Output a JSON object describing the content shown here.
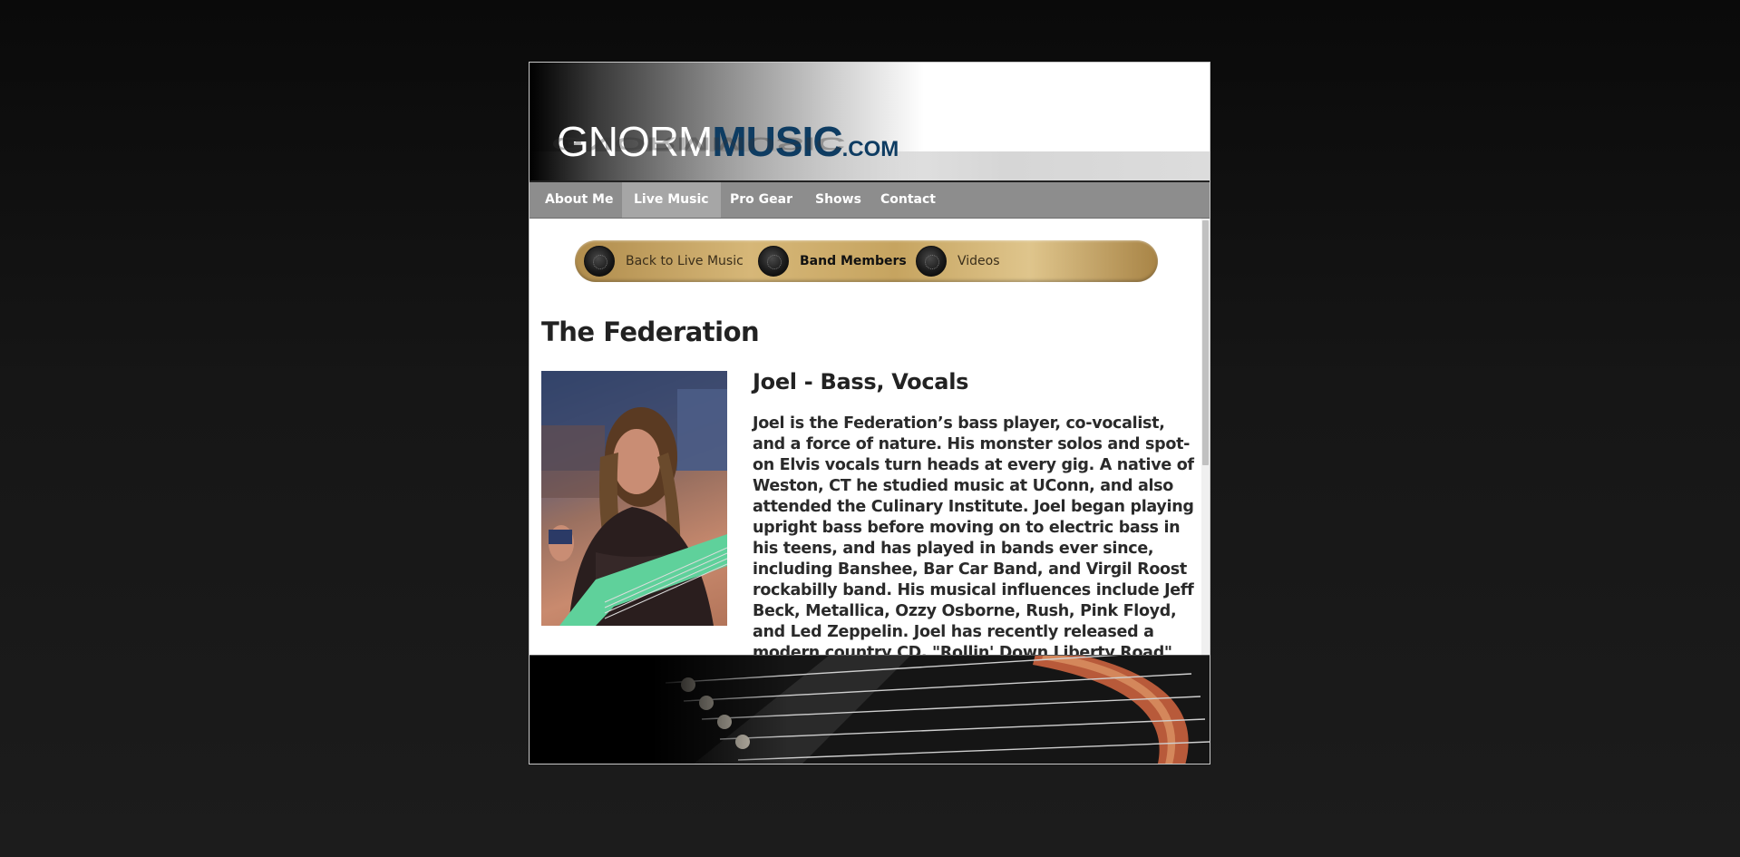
{
  "brand": {
    "part1": "GNORM",
    "part2": "MUSIC",
    "part3": ".COM"
  },
  "nav": {
    "items": [
      {
        "label": "About Me",
        "active": false
      },
      {
        "label": "Live Music",
        "active": true
      },
      {
        "label": "Pro Gear",
        "active": false
      },
      {
        "label": "Shows",
        "active": false
      },
      {
        "label": "Contact",
        "active": false
      }
    ]
  },
  "subnav": {
    "items": [
      {
        "label": "Back to Live Music",
        "icon": "volume-knob-icon"
      },
      {
        "label": "Band Members",
        "icon": "volume-knob-icon",
        "current": true
      },
      {
        "label": "Videos",
        "icon": "volume-knob-icon"
      }
    ]
  },
  "page": {
    "title": "The Federation"
  },
  "member": {
    "name": "Joel - Bass, Vocals",
    "bio": "Joel is the Federation’s bass player, co-vocalist, and a force of nature. His monster solos and spot-on Elvis vocals turn heads at every gig. A native of Weston, CT he studied music at UConn, and also attended the Culinary Institute. Joel began playing upright bass before moving on to electric bass in his teens, and has played in bands ever since, including Banshee, Bar Car Band, and Virgil Roost rockabilly band. His musical influences include Jeff Beck, Metallica, Ozzy Osborne, Rush, Pink Floyd, and Led Zeppelin. Joel has recently released a modern country CD, \"Rollin' Down Liberty Road\" (as J.Dale"
  },
  "colors": {
    "brand_blue": "#0e3c62",
    "nav_bg": "#8d8d8d",
    "nav_active": "#a6a6a6",
    "subnav_gold": "#c6a460"
  }
}
